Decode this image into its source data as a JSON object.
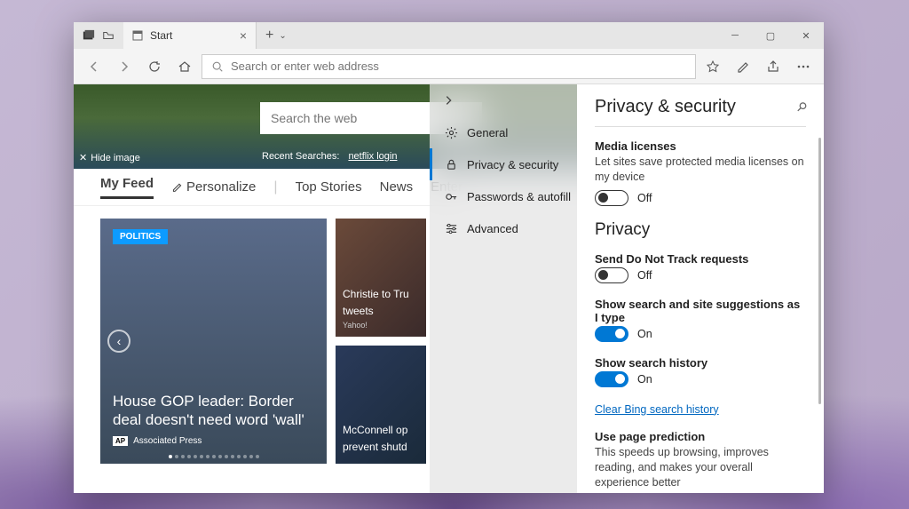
{
  "tab": {
    "label": "Start"
  },
  "address_placeholder": "Search or enter web address",
  "hero": {
    "hide_label": "Hide image",
    "search_placeholder": "Search the web",
    "recent_label": "Recent Searches:",
    "recent_term": "netflix login"
  },
  "nav": {
    "my_feed": "My Feed",
    "personalize": "Personalize",
    "top_stories": "Top Stories",
    "news": "News",
    "enter": "Enter"
  },
  "main_card": {
    "badge": "POLITICS",
    "title": "House GOP leader: Border deal doesn't need word 'wall'",
    "source_abbr": "AP",
    "source": "Associated Press"
  },
  "side_cards": {
    "a": {
      "title": "Christie to Tru",
      "sub": "tweets",
      "source": "Yahoo!"
    },
    "b": {
      "title": "McConnell op",
      "sub": "prevent shutd"
    }
  },
  "settings_nav": {
    "general": "General",
    "privacy": "Privacy & security",
    "passwords": "Passwords & autofill",
    "advanced": "Advanced"
  },
  "detail": {
    "heading": "Privacy & security",
    "media_licenses": {
      "label": "Media licenses",
      "desc": "Let sites save protected media licenses on my device",
      "state": "Off"
    },
    "privacy_heading": "Privacy",
    "dnt": {
      "label": "Send Do Not Track requests",
      "state": "Off"
    },
    "suggestions": {
      "label": "Show search and site suggestions as I type",
      "state": "On"
    },
    "history": {
      "label": "Show search history",
      "state": "On"
    },
    "clear_link": "Clear Bing search history",
    "prediction": {
      "label": "Use page prediction",
      "desc": "This speeds up browsing, improves reading, and makes your overall experience better"
    }
  }
}
